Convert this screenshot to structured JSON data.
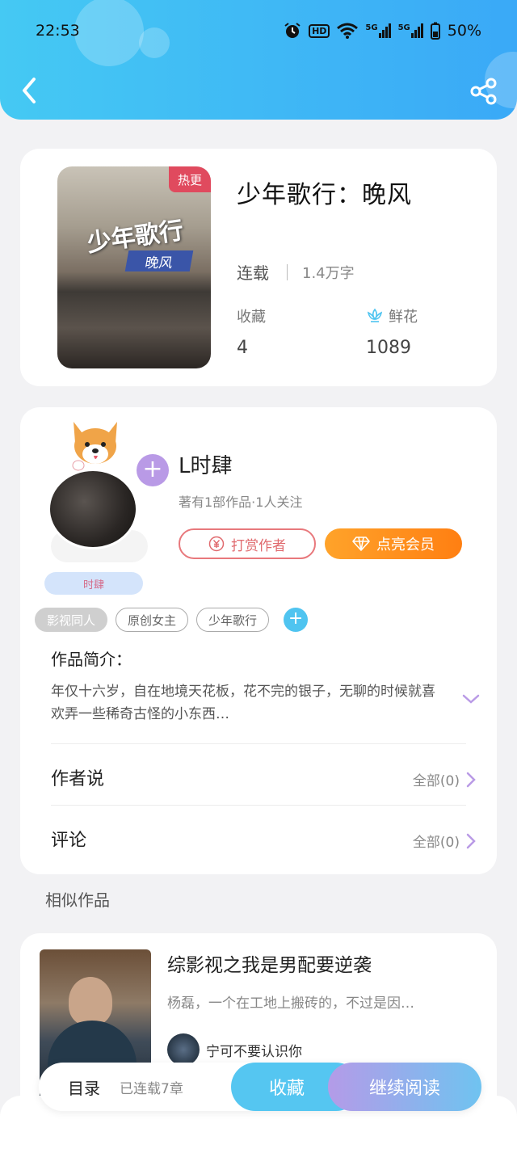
{
  "status_bar": {
    "time": "22:53",
    "hd_label": "HD",
    "net1": "5G",
    "net2": "5G",
    "battery": "50%"
  },
  "book": {
    "cover_tag": "热更",
    "cover_title": "少年歌行",
    "cover_subtitle": "晚风",
    "title": "少年歌行：晚风",
    "status": "连载",
    "word_count": "1.4万字",
    "favorites_label": "收藏",
    "favorites_value": "4",
    "flowers_label": "鲜花",
    "flowers_value": "1089"
  },
  "author": {
    "avatar_name": "时肆",
    "name": "L时肆",
    "meta": "著有1部作品·1人关注",
    "tip_label": "打赏作者",
    "vip_label": "点亮会员",
    "tags": [
      "影视同人",
      "原创女主",
      "少年歌行"
    ],
    "intro_label": "作品简介：",
    "intro_text": "年仅十六岁，自在地境天花板，花不完的银子，无聊的时候就喜欢弄一些稀奇古怪的小东西…",
    "author_says_label": "作者说",
    "author_says_right": "全部(0)",
    "comments_label": "评论",
    "comments_right": "全部(0)"
  },
  "similar": {
    "section_title": "相似作品",
    "items": [
      {
        "title": "综影视之我是男配要逆袭",
        "desc": "杨磊，一个在工地上搬砖的，不过是因…",
        "author": "宁可不要认识你"
      }
    ]
  },
  "bottom_bar": {
    "toc_label": "目录",
    "toc_count": "已连载7章",
    "favorite_label": "收藏",
    "read_label": "继续阅读"
  },
  "colors": {
    "header_start": "#45c9f3",
    "header_end": "#3aa9f7",
    "vip_orange": "#ff8c1a",
    "tip_red": "#e06a6e",
    "accent_blue": "#4fc4f0",
    "accent_purple": "#b99ae6"
  }
}
